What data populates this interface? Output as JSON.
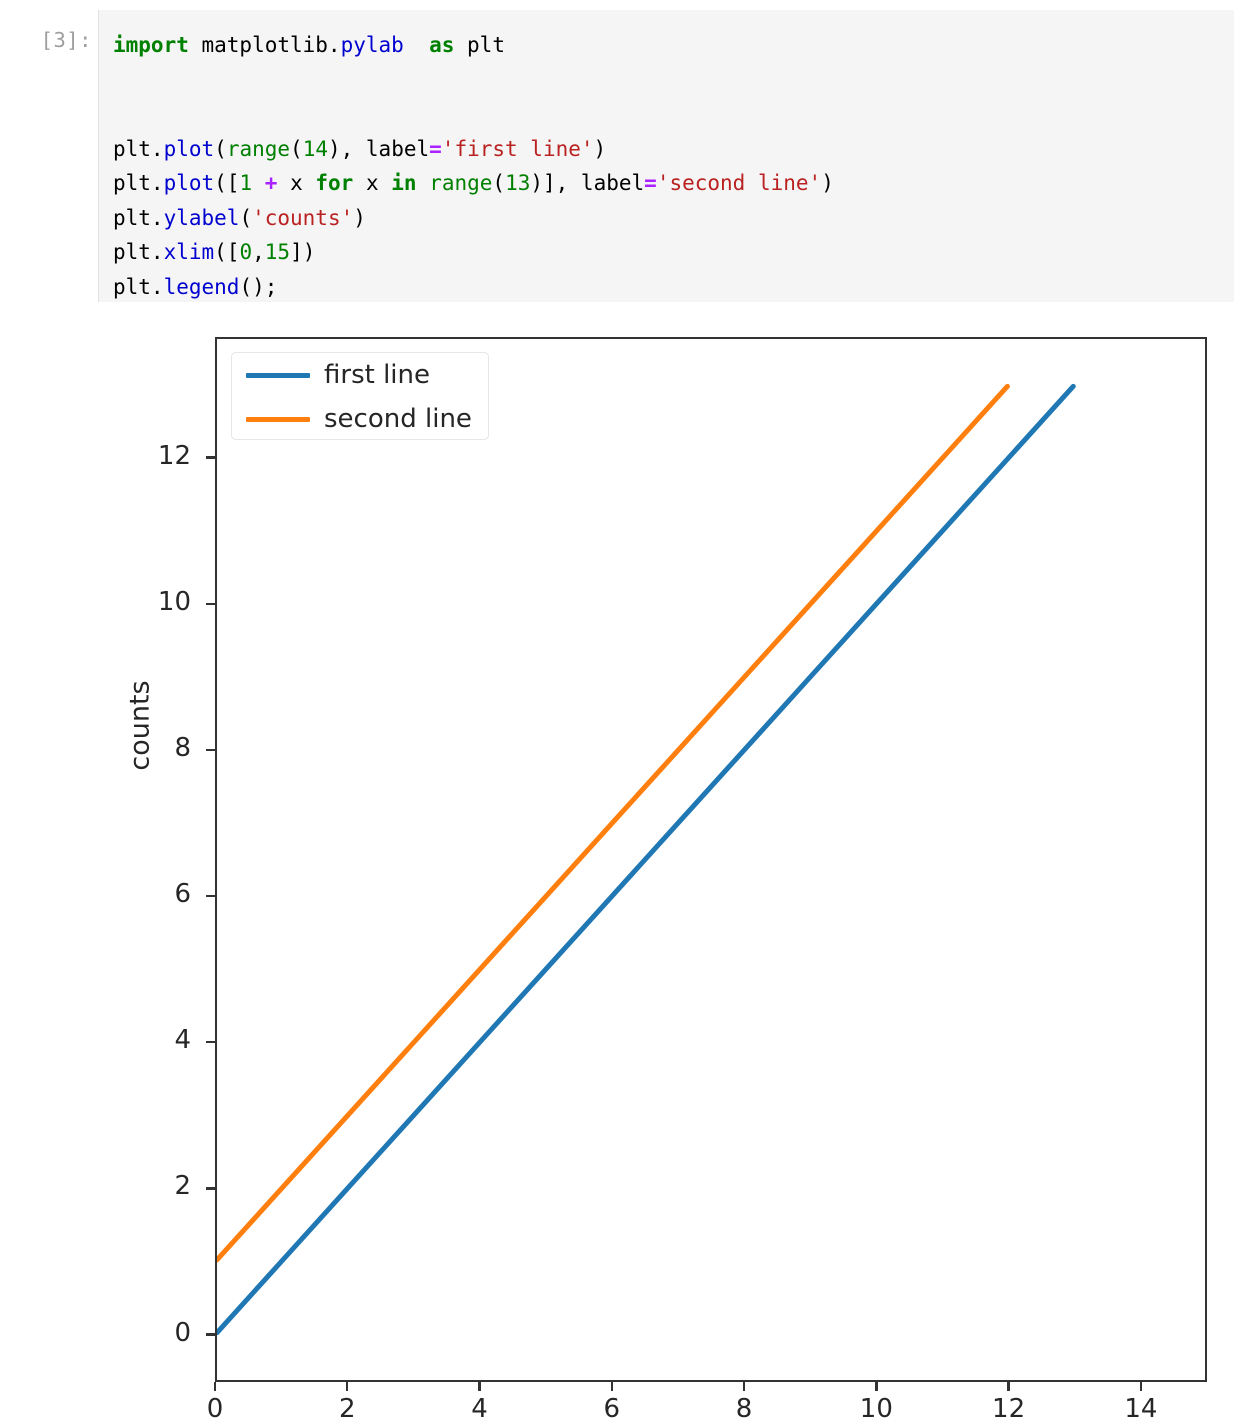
{
  "notebook": {
    "prompt": "[3]:",
    "code_lines": [
      [
        {
          "t": "import",
          "c": "kw"
        },
        {
          "t": " matplotlib.",
          "c": "plain"
        },
        {
          "t": "pylab",
          "c": "mod"
        },
        {
          "t": "  ",
          "c": "plain"
        },
        {
          "t": "as",
          "c": "kw"
        },
        {
          "t": " plt",
          "c": "plain"
        }
      ],
      [],
      [],
      [
        {
          "t": "plt.",
          "c": "plain"
        },
        {
          "t": "plot",
          "c": "fn"
        },
        {
          "t": "(",
          "c": "plain"
        },
        {
          "t": "range",
          "c": "bi"
        },
        {
          "t": "(",
          "c": "plain"
        },
        {
          "t": "14",
          "c": "num"
        },
        {
          "t": "), label",
          "c": "plain"
        },
        {
          "t": "=",
          "c": "op"
        },
        {
          "t": "'first line'",
          "c": "str"
        },
        {
          "t": ")",
          "c": "plain"
        }
      ],
      [
        {
          "t": "plt.",
          "c": "plain"
        },
        {
          "t": "plot",
          "c": "fn"
        },
        {
          "t": "([",
          "c": "plain"
        },
        {
          "t": "1",
          "c": "num"
        },
        {
          "t": " ",
          "c": "plain"
        },
        {
          "t": "+",
          "c": "op"
        },
        {
          "t": " x ",
          "c": "plain"
        },
        {
          "t": "for",
          "c": "kw"
        },
        {
          "t": " x ",
          "c": "plain"
        },
        {
          "t": "in",
          "c": "kw"
        },
        {
          "t": " ",
          "c": "plain"
        },
        {
          "t": "range",
          "c": "bi"
        },
        {
          "t": "(",
          "c": "plain"
        },
        {
          "t": "13",
          "c": "num"
        },
        {
          "t": ")], label",
          "c": "plain"
        },
        {
          "t": "=",
          "c": "op"
        },
        {
          "t": "'second line'",
          "c": "str"
        },
        {
          "t": ")",
          "c": "plain"
        }
      ],
      [
        {
          "t": "plt.",
          "c": "plain"
        },
        {
          "t": "ylabel",
          "c": "fn"
        },
        {
          "t": "(",
          "c": "plain"
        },
        {
          "t": "'counts'",
          "c": "str"
        },
        {
          "t": ")",
          "c": "plain"
        }
      ],
      [
        {
          "t": "plt.",
          "c": "plain"
        },
        {
          "t": "xlim",
          "c": "fn"
        },
        {
          "t": "([",
          "c": "plain"
        },
        {
          "t": "0",
          "c": "num"
        },
        {
          "t": ",",
          "c": "plain"
        },
        {
          "t": "15",
          "c": "num"
        },
        {
          "t": "])",
          "c": "plain"
        }
      ],
      [
        {
          "t": "plt.",
          "c": "plain"
        },
        {
          "t": "legend",
          "c": "fn"
        },
        {
          "t": "();",
          "c": "plain"
        }
      ]
    ]
  },
  "chart_data": {
    "type": "line",
    "title": "",
    "xlabel": "",
    "ylabel": "counts",
    "xlim": [
      0,
      15
    ],
    "ylim": [
      -0.65,
      13.65
    ],
    "grid": false,
    "legend_position": "upper left",
    "xticks": [
      0,
      2,
      4,
      6,
      8,
      10,
      12,
      14
    ],
    "xtick_labels": [
      "0",
      "2",
      "4",
      "6",
      "8",
      "10",
      "12",
      "14"
    ],
    "yticks": [
      0,
      2,
      4,
      6,
      8,
      10,
      12
    ],
    "ytick_labels": [
      "0",
      "2",
      "4",
      "6",
      "8",
      "10",
      "12"
    ],
    "series": [
      {
        "name": "first line",
        "color": "#1f77b4",
        "x": [
          0,
          1,
          2,
          3,
          4,
          5,
          6,
          7,
          8,
          9,
          10,
          11,
          12,
          13
        ],
        "values": [
          0,
          1,
          2,
          3,
          4,
          5,
          6,
          7,
          8,
          9,
          10,
          11,
          12,
          13
        ]
      },
      {
        "name": "second line",
        "color": "#ff7f0e",
        "x": [
          0,
          1,
          2,
          3,
          4,
          5,
          6,
          7,
          8,
          9,
          10,
          11,
          12
        ],
        "values": [
          1,
          2,
          3,
          4,
          5,
          6,
          7,
          8,
          9,
          10,
          11,
          12,
          13
        ]
      }
    ]
  }
}
